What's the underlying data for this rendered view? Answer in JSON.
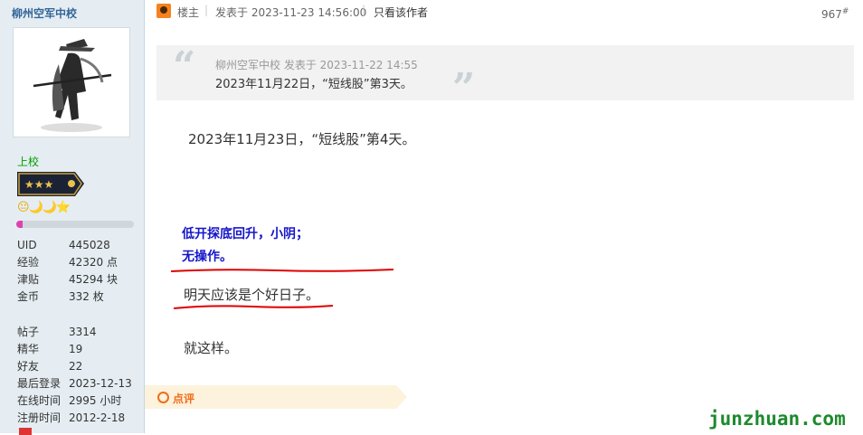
{
  "sidebar": {
    "username": "柳州空军中校",
    "rank": "上校",
    "stats_a": [
      {
        "k": "UID",
        "v": "445028"
      },
      {
        "k": "经验",
        "v": "42320 点"
      },
      {
        "k": "津贴",
        "v": "45294 块"
      },
      {
        "k": "金币",
        "v": "332 枚"
      }
    ],
    "stats_b": [
      {
        "k": "帖子",
        "v": "3314"
      },
      {
        "k": "精华",
        "v": "19"
      },
      {
        "k": "好友",
        "v": "22"
      },
      {
        "k": "最后登录",
        "v": "2023-12-13"
      },
      {
        "k": "在线时间",
        "v": "2995 小时"
      },
      {
        "k": "注册时间",
        "v": "2012-2-18"
      }
    ],
    "level_progress": 0.05,
    "medals": "😐🌙🌙⭐"
  },
  "post_header": {
    "owner_label": "楼主",
    "separator": "|",
    "posted_at": "发表于 2023-11-23 14:56:00",
    "author_only": "只看该作者",
    "floor": "967",
    "floor_suffix": "#"
  },
  "quote": {
    "meta": "柳州空军中校 发表于 2023-11-22 14:55",
    "text": "2023年11月22日，“短线股”第3天。",
    "open_mark": "“",
    "close_mark": "”"
  },
  "body": {
    "line1": "2023年11月23日，“短线股”第4天。",
    "blue_1": "低开探底回升，小阴；",
    "blue_2": "无操作。",
    "line_mid": "明天应该是个好日子。",
    "line_end": "就这样。"
  },
  "comment": {
    "label": "点评"
  },
  "watermark": "junzhuan.com",
  "colors": {
    "accent": "#f26c1a",
    "blue_text": "#1515c9",
    "underline": "#e00000",
    "watermark": "#1d8a2e"
  }
}
